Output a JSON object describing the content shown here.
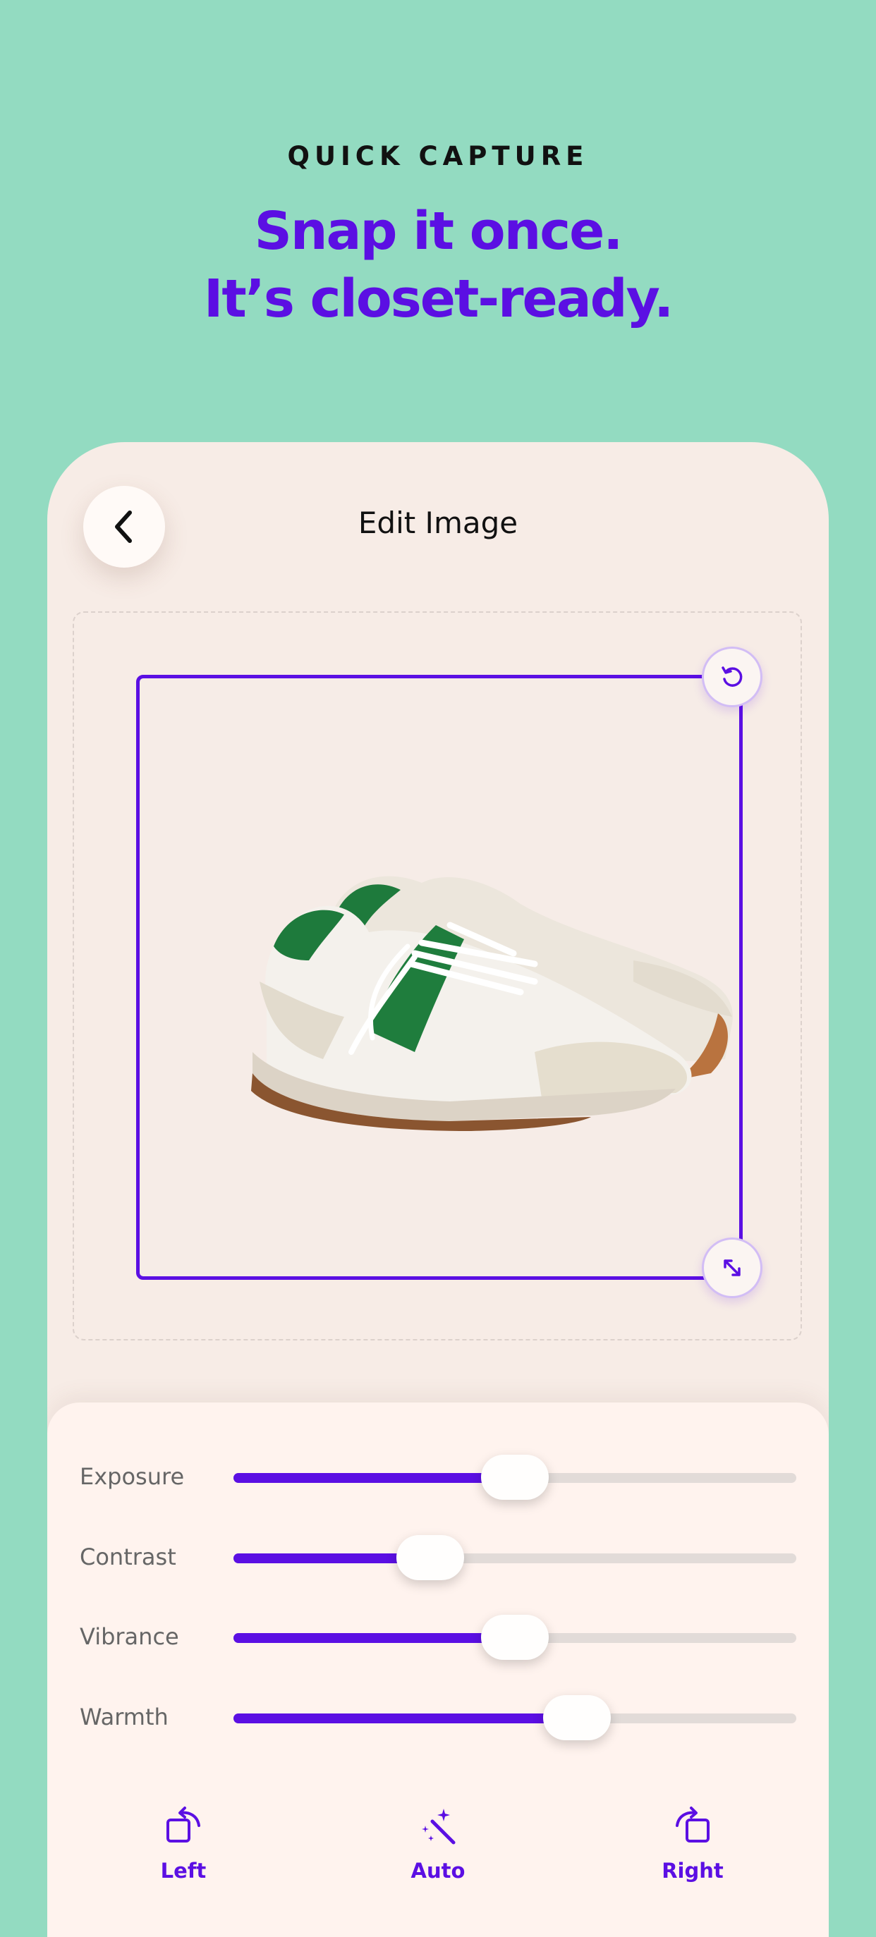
{
  "hero": {
    "eyebrow": "QUICK CAPTURE",
    "headline_line1": "Snap it once.",
    "headline_line2": "It’s closet-ready."
  },
  "editor": {
    "title": "Edit Image",
    "back_icon": "chevron-left-icon",
    "rotate_handle_icon": "rotate-ccw-icon",
    "resize_handle_icon": "resize-diagonal-icon"
  },
  "adjustments": [
    {
      "label": "Exposure",
      "value": 0.5
    },
    {
      "label": "Contrast",
      "value": 0.35
    },
    {
      "label": "Vibrance",
      "value": 0.5
    },
    {
      "label": "Warmth",
      "value": 0.61
    }
  ],
  "tools": [
    {
      "label": "Left",
      "icon": "rotate-left-icon"
    },
    {
      "label": "Auto",
      "icon": "magic-wand-icon"
    },
    {
      "label": "Right",
      "icon": "rotate-right-icon"
    }
  ],
  "colors": {
    "background": "#93dbc1",
    "accent": "#5b0fe3",
    "card": "#f7ece6"
  }
}
